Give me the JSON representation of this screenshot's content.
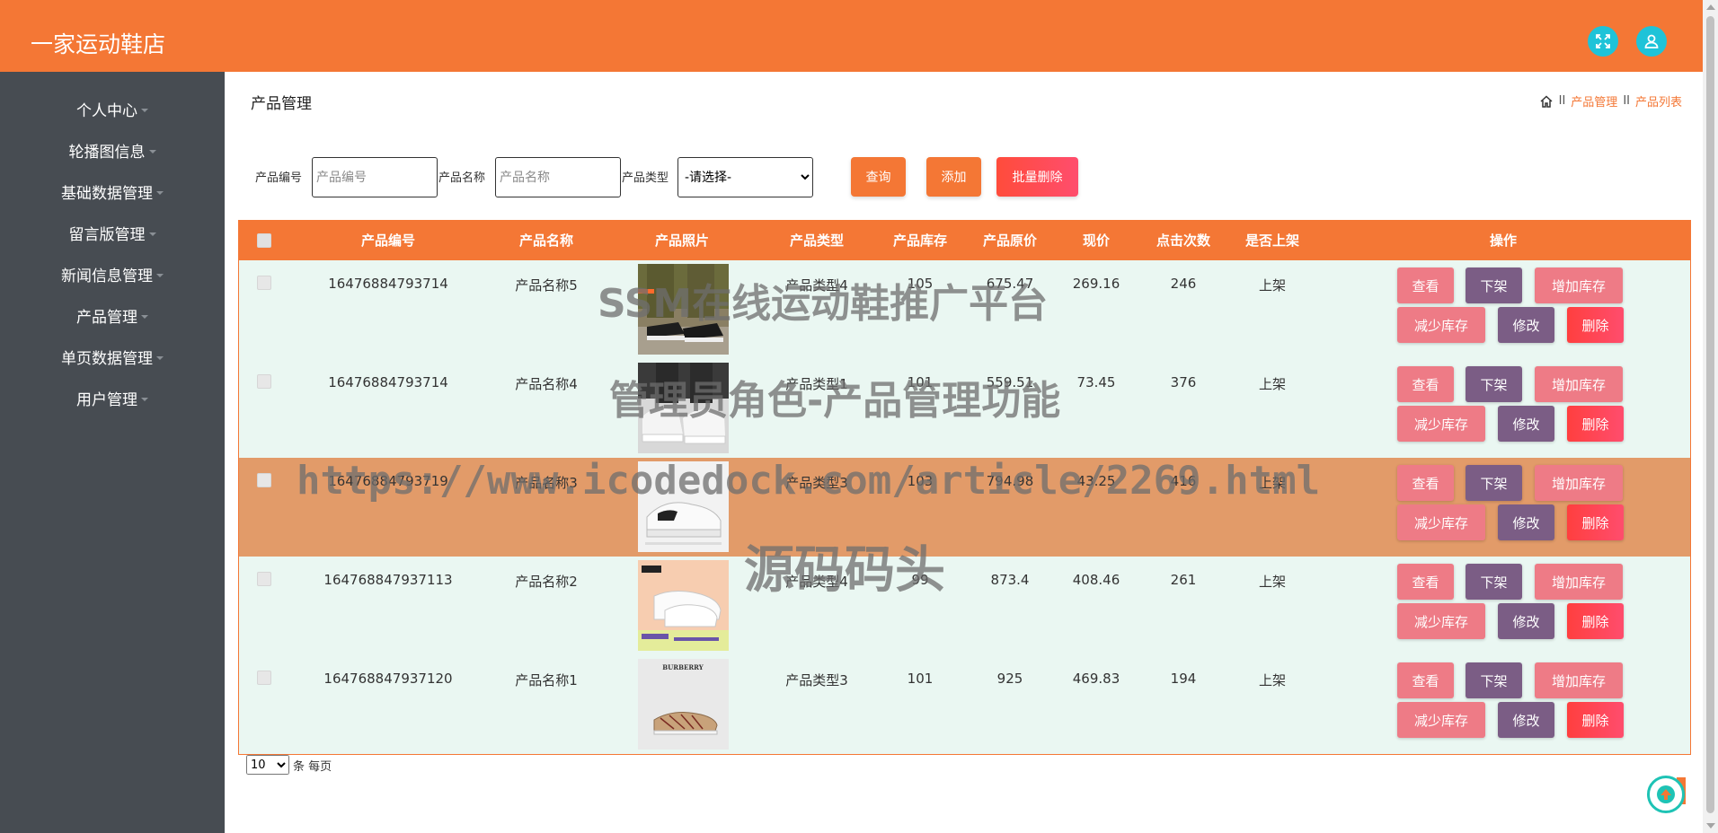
{
  "header": {
    "app_title": "一家运动鞋店",
    "icons": [
      "fullscreen-icon",
      "user-icon"
    ],
    "accent": "#f47735"
  },
  "sidebar": {
    "items": [
      {
        "label": "个人中心"
      },
      {
        "label": "轮播图信息"
      },
      {
        "label": "基础数据管理"
      },
      {
        "label": "留言版管理"
      },
      {
        "label": "新闻信息管理"
      },
      {
        "label": "产品管理"
      },
      {
        "label": "单页数据管理"
      },
      {
        "label": "用户管理"
      }
    ]
  },
  "page": {
    "title": "产品管理",
    "breadcrumb": {
      "sep": "II",
      "level1": "产品管理",
      "level2": "产品列表"
    }
  },
  "search": {
    "code_label": "产品编号",
    "code_placeholder": "产品编号",
    "name_label": "产品名称",
    "name_placeholder": "产品名称",
    "type_label": "产品类型",
    "type_selected": "-请选择-",
    "query_btn": "查询",
    "add_btn": "添加",
    "batch_delete_btn": "批量删除"
  },
  "table": {
    "columns": [
      "产品编号",
      "产品名称",
      "产品照片",
      "产品类型",
      "产品库存",
      "产品原价",
      "现价",
      "点击次数",
      "是否上架",
      "操作"
    ],
    "rows": [
      {
        "code": "16476884793714",
        "name": "产品名称5",
        "type": "产品类型4",
        "stock": "105",
        "orig": "675.47",
        "price": "269.16",
        "clicks": "246",
        "status": "上架",
        "photo": "shoe-photo-1"
      },
      {
        "code": "16476884793714",
        "name": "产品名称4",
        "type": "产品类型1",
        "stock": "101",
        "orig": "559.51",
        "price": "73.45",
        "clicks": "376",
        "status": "上架",
        "photo": "shoe-photo-2"
      },
      {
        "code": "16476884793719",
        "name": "产品名称3",
        "type": "产品类型3",
        "stock": "103",
        "orig": "794.98",
        "price": "43.25",
        "clicks": "416",
        "status": "上架",
        "photo": "shoe-photo-3"
      },
      {
        "code": "164768847937113",
        "name": "产品名称2",
        "type": "产品类型4",
        "stock": "99",
        "orig": "873.4",
        "price": "408.46",
        "clicks": "261",
        "status": "上架",
        "photo": "shoe-photo-4"
      },
      {
        "code": "164768847937120",
        "name": "产品名称1",
        "type": "产品类型3",
        "stock": "101",
        "orig": "925",
        "price": "469.83",
        "clicks": "194",
        "status": "上架",
        "photo": "shoe-photo-5"
      }
    ],
    "actions": {
      "view": "查看",
      "off_shelf": "下架",
      "add_stock": "增加库存",
      "reduce_stock": "减少库存",
      "edit": "修改",
      "delete": "删除"
    }
  },
  "photo_text": {
    "row5_brand": "BURBERRY"
  },
  "pagination": {
    "page_size": "10",
    "suffix": "条 每页"
  },
  "watermark": {
    "line1": "SSM在线运动鞋推广平台",
    "line2": "管理员角色-产品管理功能",
    "line3": "https://www.icodedock.com/article/2269.html",
    "line4": "源码码头"
  }
}
